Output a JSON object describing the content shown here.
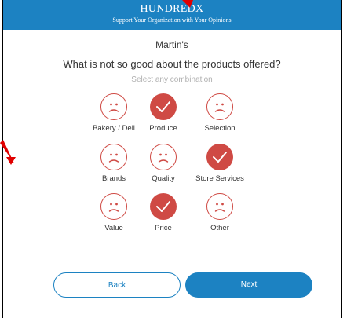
{
  "header": {
    "brand": "HUNDREDX",
    "tagline": "Support Your Organization with Your Opinions"
  },
  "store_name": "Martin's",
  "question": "What is not so good about the products offered?",
  "hint": "Select any combination",
  "options": [
    {
      "label": "Bakery / Deli",
      "selected": false,
      "icon": "sad-face-icon"
    },
    {
      "label": "Produce",
      "selected": true,
      "icon": "checkmark-icon"
    },
    {
      "label": "Selection",
      "selected": false,
      "icon": "sad-face-icon"
    },
    {
      "label": "Brands",
      "selected": false,
      "icon": "sad-face-icon"
    },
    {
      "label": "Quality",
      "selected": false,
      "icon": "sad-face-icon"
    },
    {
      "label": "Store Services",
      "selected": true,
      "icon": "checkmark-icon"
    },
    {
      "label": "Value",
      "selected": false,
      "icon": "sad-face-icon"
    },
    {
      "label": "Price",
      "selected": true,
      "icon": "checkmark-icon"
    },
    {
      "label": "Other",
      "selected": false,
      "icon": "sad-face-icon"
    }
  ],
  "buttons": {
    "back": "Back",
    "next": "Next"
  },
  "colors": {
    "brand_blue": "#1c82c2",
    "accent_red": "#cf4a44",
    "annotation_arrow": "#e00000"
  }
}
